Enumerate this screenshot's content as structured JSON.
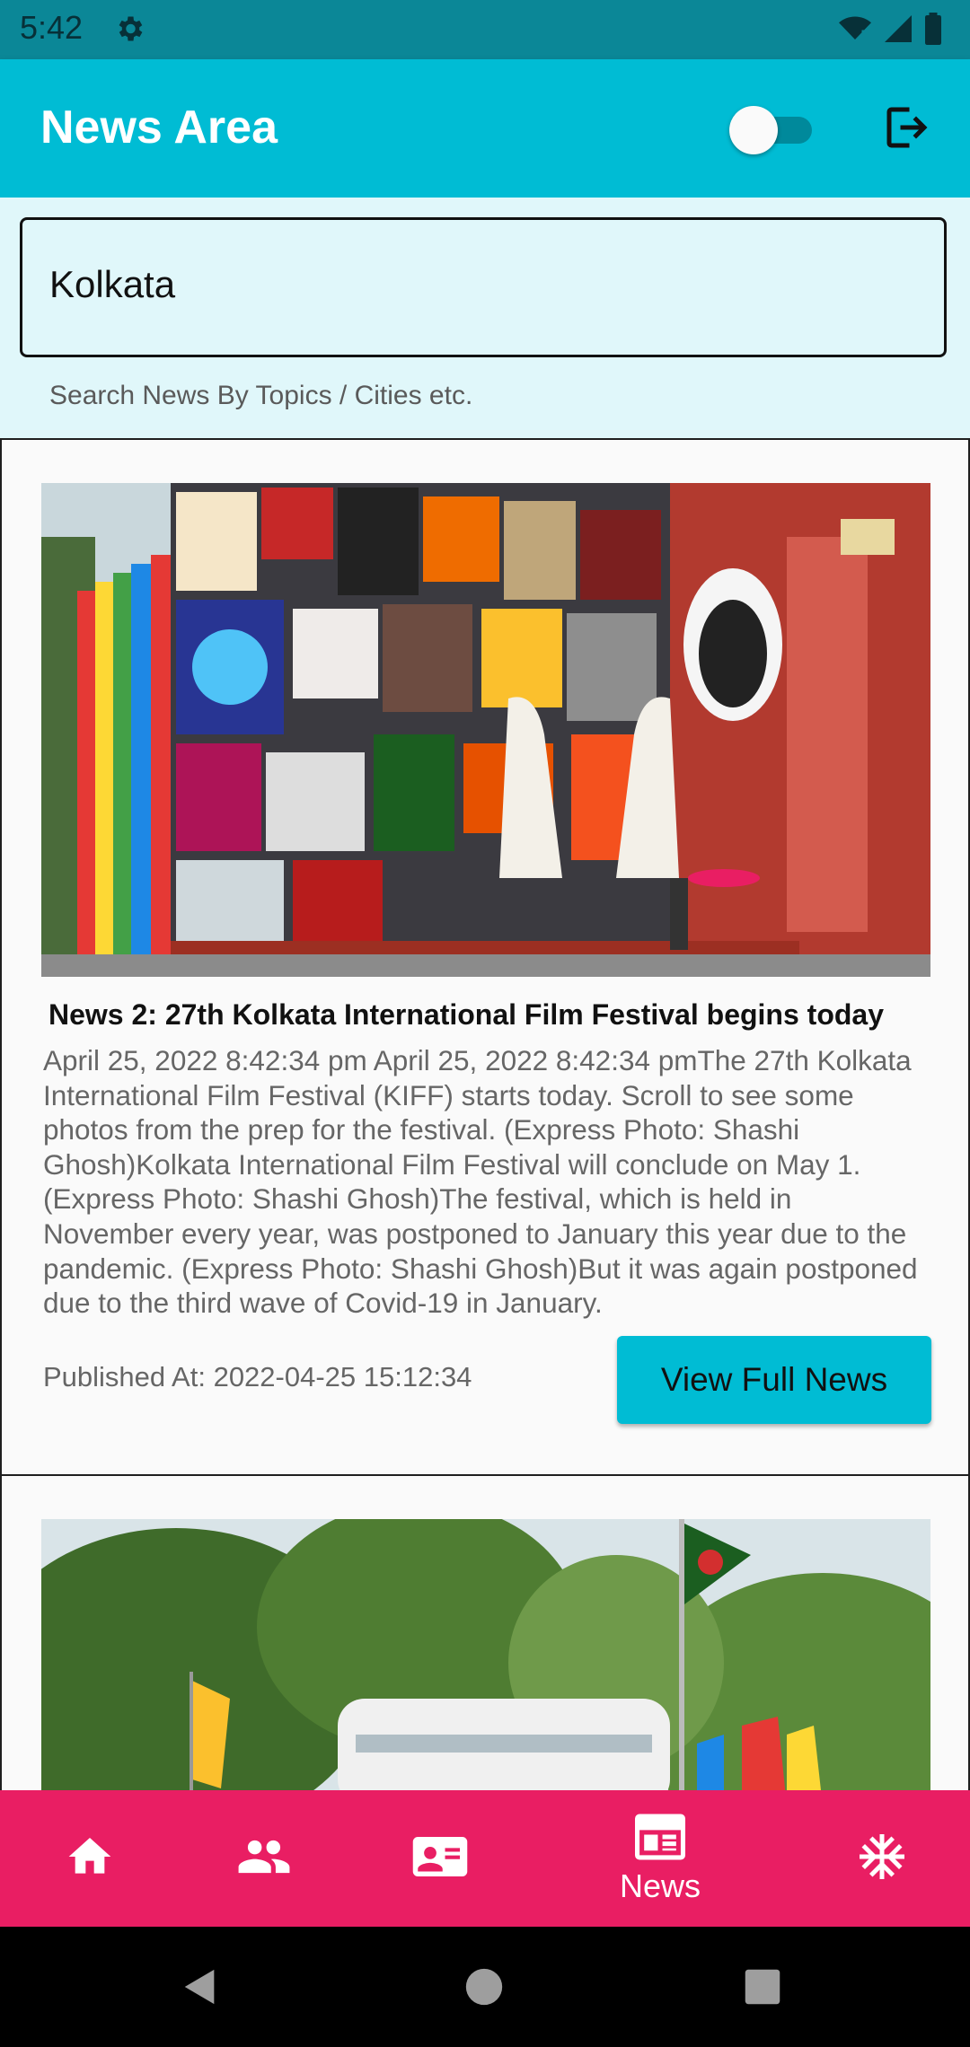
{
  "status_bar": {
    "time": "5:42"
  },
  "app_bar": {
    "title": "News Area",
    "theme_toggle_on": false
  },
  "search": {
    "value": "Kolkata",
    "helper": "Search News By Topics / Cities etc."
  },
  "news": [
    {
      "title": "News 2: 27th Kolkata International Film Festival begins today",
      "body": "April 25, 2022 8:42:34 pm April 25, 2022 8:42:34 pmThe 27th Kolkata International Film Festival (KIFF) starts today. Scroll to see some photos from the prep for the festival. (Express Photo: Shashi Ghosh)Kolkata International Film Festival will conclude on May 1. (Express Photo: Shashi Ghosh)The festival, which is held in November every year, was postponed to January this year due to the pandemic. (Express Photo: Shashi Ghosh)But it was again postponed due to the third wave of Covid-19 in January.",
      "published": "Published At: 2022-04-25 15:12:34",
      "button_label": "View Full News"
    }
  ],
  "bottom_nav": {
    "items": [
      {
        "icon": "home-icon",
        "label": ""
      },
      {
        "icon": "people-icon",
        "label": ""
      },
      {
        "icon": "contact-card-icon",
        "label": ""
      },
      {
        "icon": "newspaper-icon",
        "label": "News",
        "active": true
      },
      {
        "icon": "snowflake-icon",
        "label": ""
      }
    ]
  },
  "colors": {
    "status_bar": "#0b8797",
    "app_bar": "#00bcd4",
    "search_bg": "#e0f7fa",
    "bottom_nav": "#e91e63",
    "button": "#00bcd4"
  }
}
